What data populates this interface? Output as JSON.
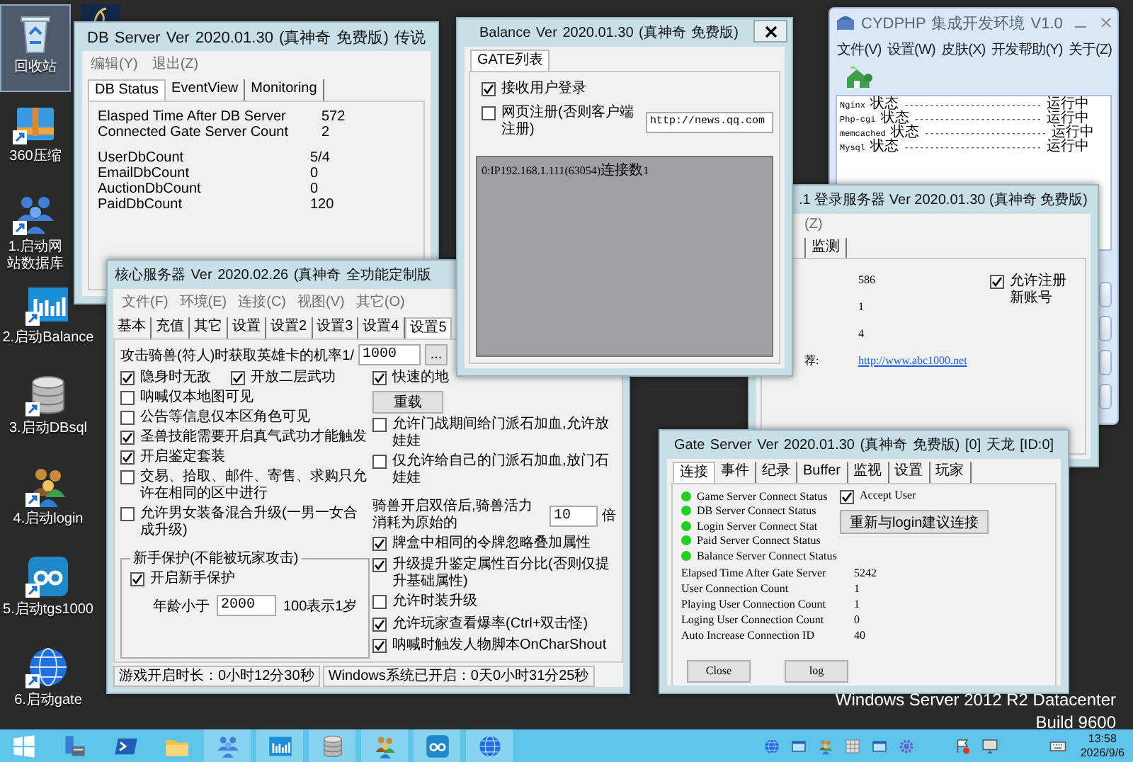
{
  "desktop_icons": [
    {
      "label": "回收站",
      "selected": true
    },
    {
      "label": "360压缩",
      "selected": false
    },
    {
      "label": "1.启动网站数据库",
      "selected": false
    },
    {
      "label": "2.启动Balance",
      "selected": false
    },
    {
      "label": "3.启动DBsql",
      "selected": false
    },
    {
      "label": "4.启动login",
      "selected": false
    },
    {
      "label": "5.启动tgs1000",
      "selected": false
    },
    {
      "label": "6.启动gate",
      "selected": false
    }
  ],
  "db_server": {
    "title": "DB Server Ver 2020.01.30 (真神奇 免费版) 传说",
    "menu": [
      "编辑(Y)",
      "退出(Z)"
    ],
    "tabs": [
      {
        "label": "DB Status",
        "selected": true
      },
      {
        "label": "EventView",
        "selected": false
      },
      {
        "label": "Monitoring",
        "selected": false
      }
    ],
    "stats": [
      {
        "label": "Elasped Time After DB Server",
        "value": "572"
      },
      {
        "label": "Connected Gate Server Count",
        "value": "2"
      }
    ],
    "counts": [
      {
        "label": "UserDbCount",
        "value": "5/4"
      },
      {
        "label": "EmailDbCount",
        "value": "0"
      },
      {
        "label": "AuctionDbCount",
        "value": "0"
      },
      {
        "label": "PaidDbCount",
        "value": "120"
      }
    ]
  },
  "cydphp": {
    "title": "CYDPHP  集成开发环境  V1.0",
    "menu": [
      "文件(V)",
      "设置(W)",
      "皮肤(X)",
      "开发帮助(Y)",
      "关于(Z)"
    ],
    "services": [
      "Nginx 状态 --------------------------- 运行中",
      "Php-cgi 状态 ------------------------- 运行中",
      "memcached 状态 ------------------------ 运行中",
      "Mysql 状态 --------------------------- 运行中"
    ]
  },
  "login_server": {
    "title": ".1 登录服务器 Ver 2020.01.30 (真神奇 免费版)",
    "menu": [
      "(Z)"
    ],
    "tabs": [
      {
        "label": "监测",
        "selected": false
      }
    ],
    "values": [
      "586",
      "1",
      "4"
    ],
    "link_label": "荐:",
    "link": "http://www.abc1000.net",
    "allow_register": {
      "label": "允许注册新账号",
      "checked": true
    }
  },
  "core_server": {
    "title": "核心服务器 Ver 2020.02.26 (真神奇 全功能定制版",
    "menu": [
      "文件(F)",
      "环境(E)",
      "连接(C)",
      "视图(V)",
      "其它(O)"
    ],
    "tabs": [
      {
        "label": "基本",
        "selected": false
      },
      {
        "label": "充值",
        "selected": false
      },
      {
        "label": "其它",
        "selected": false
      },
      {
        "label": "设置",
        "selected": false
      },
      {
        "label": "设置2",
        "selected": false
      },
      {
        "label": "设置3",
        "selected": false
      },
      {
        "label": "设置4",
        "selected": false
      },
      {
        "label": "设置5",
        "selected": true
      }
    ],
    "hero_card": {
      "label": "攻击骑兽(符人)时获取英雄卡的机率1/",
      "value": "1000",
      "more_button": "..."
    },
    "left_options": [
      [
        {
          "label": "隐身时无敌",
          "checked": true
        },
        {
          "label": "开放二层武功",
          "checked": true
        }
      ],
      [
        {
          "label": "呐喊仅本地图可见",
          "checked": false
        }
      ],
      [
        {
          "label": "公告等信息仅本区角色可见",
          "checked": false
        }
      ],
      [
        {
          "label": "圣兽技能需要开启真气武功才能触发",
          "checked": true
        }
      ],
      [
        {
          "label": "开启鉴定套装",
          "checked": true
        }
      ],
      [
        {
          "label": "交易、拾取、邮件、寄售、求购只允许在相同的区中进行",
          "checked": false
        }
      ],
      [
        {
          "label": "允许男女装备混合升级(一男一女合成升级)",
          "checked": false
        }
      ]
    ],
    "newbie": {
      "title": "新手保护(不能被玩家攻击)",
      "enable": {
        "label": "开启新手保护",
        "checked": true
      },
      "age_label": "年龄小于",
      "age_value": "2000",
      "age_hint": "100表示1岁"
    },
    "fast_option": {
      "label": "快速的地",
      "checked": true
    },
    "reload_button": "重载",
    "right_options_top": [
      {
        "label": "允许门战期间给门派石加血,允许放娃娃",
        "checked": false
      },
      {
        "label": "仅允许给自己的门派石加血,放门石娃娃",
        "checked": false
      }
    ],
    "mount": {
      "label": "骑兽开启双倍后,骑兽活力消耗为原始的",
      "value": "10",
      "unit": "倍"
    },
    "right_options": [
      {
        "label": "牌盒中相同的令牌忽略叠加属性",
        "checked": true
      },
      {
        "label": "升级提升鉴定属性百分比(否则仅提升基础属性)",
        "checked": true
      },
      {
        "label": "允许时装升级",
        "checked": false
      },
      {
        "label": "允许玩家查看爆率(Ctrl+双击怪)",
        "checked": true
      },
      {
        "label": "呐喊时触发人物脚本OnCharShout",
        "checked": true
      }
    ],
    "status": [
      "游戏开启时长：0小时12分30秒",
      "Windows系统已开启：0天0小时31分25秒"
    ]
  },
  "balance": {
    "title": "Balance Ver 2020.01.30 (真神奇 免费版)",
    "tabs": [
      {
        "label": "GATE列表",
        "selected": true
      }
    ],
    "accept_login": {
      "label": "接收用户登录",
      "checked": true
    },
    "web_register": {
      "label": "网页注册(否则客户端注册)",
      "checked": false,
      "url": "http://news.qq.com"
    },
    "connections": [
      "0:IP192.168.1.111(63054)连接数1"
    ]
  },
  "gate_server": {
    "title": "Gate Server Ver 2020.01.30 (真神奇 免费版) [0] 天龙 [ID:0]",
    "tabs": [
      {
        "label": "连接",
        "selected": true
      },
      {
        "label": "事件",
        "selected": false
      },
      {
        "label": "纪录",
        "selected": false
      },
      {
        "label": "Buffer",
        "selected": false
      },
      {
        "label": "监视",
        "selected": false
      },
      {
        "label": "设置",
        "selected": false
      },
      {
        "label": "玩家",
        "selected": false
      }
    ],
    "links": [
      {
        "label": "Game Server Connect Status",
        "connected": true
      },
      {
        "label": "DB Server Connect Status",
        "connected": true
      },
      {
        "label": "Login Server Connect Stat",
        "connected": true
      },
      {
        "label": "Paid Server Connect Status",
        "connected": true
      },
      {
        "label": "Balance Server Connect Status",
        "connected": true
      }
    ],
    "accept_user": {
      "label": "Accept User",
      "checked": true
    },
    "reconnect_button": "重新与login建议连接",
    "stats": [
      {
        "label": "Elapsed Time After Gate Server",
        "value": "5242"
      },
      {
        "label": "User Connection Count",
        "value": "1"
      },
      {
        "label": "Playing User Connection Count",
        "value": "1"
      },
      {
        "label": "Loging User Connection Count",
        "value": "0"
      },
      {
        "label": "Auto Increase Connection ID",
        "value": "40"
      }
    ],
    "buttons": [
      "Close",
      "log"
    ]
  },
  "os_info": [
    "Windows Server 2012 R2 Datacenter",
    "Build 9600"
  ],
  "clock": {
    "time": "13:58",
    "date": "2026/9/6"
  }
}
